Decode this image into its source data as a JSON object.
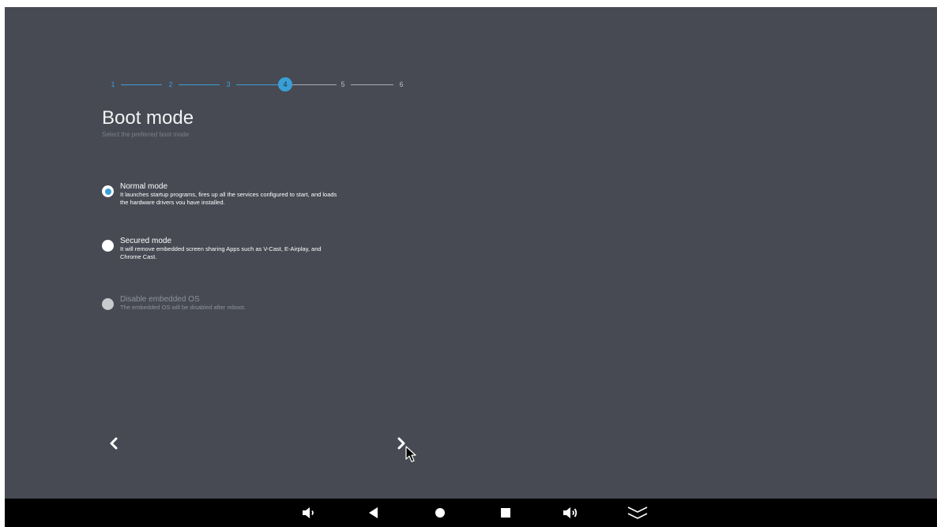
{
  "stepper": {
    "steps": [
      "1",
      "2",
      "3",
      "4",
      "5",
      "6"
    ],
    "current_step": 4
  },
  "page": {
    "title": "Boot mode",
    "subtitle": "Select the preferred boot mode"
  },
  "options": [
    {
      "title": "Normal mode",
      "description": "It launches startup programs, fires up all the services configured to start, and loads the hardware drivers you have installed.",
      "selected": true,
      "enabled": true
    },
    {
      "title": "Secured mode",
      "description": "It will remove embedded screen sharing Apps such as V-Cast, E-Airplay, and Chrome Cast.",
      "selected": false,
      "enabled": true
    },
    {
      "title": "Disable embedded OS",
      "description": "The embedded OS will be disabled after reboot.",
      "selected": false,
      "enabled": false
    }
  ],
  "navigation": {
    "back_icon": "chevron-left-icon",
    "next_icon": "chevron-right-icon"
  },
  "system_bar": {
    "buttons": [
      "volume-down-icon",
      "back-icon",
      "home-icon",
      "recents-icon",
      "volume-up-icon",
      "collapse-icon"
    ]
  },
  "colors": {
    "background": "#474a53",
    "accent": "#3a9fd6",
    "system_bar": "#000000"
  }
}
